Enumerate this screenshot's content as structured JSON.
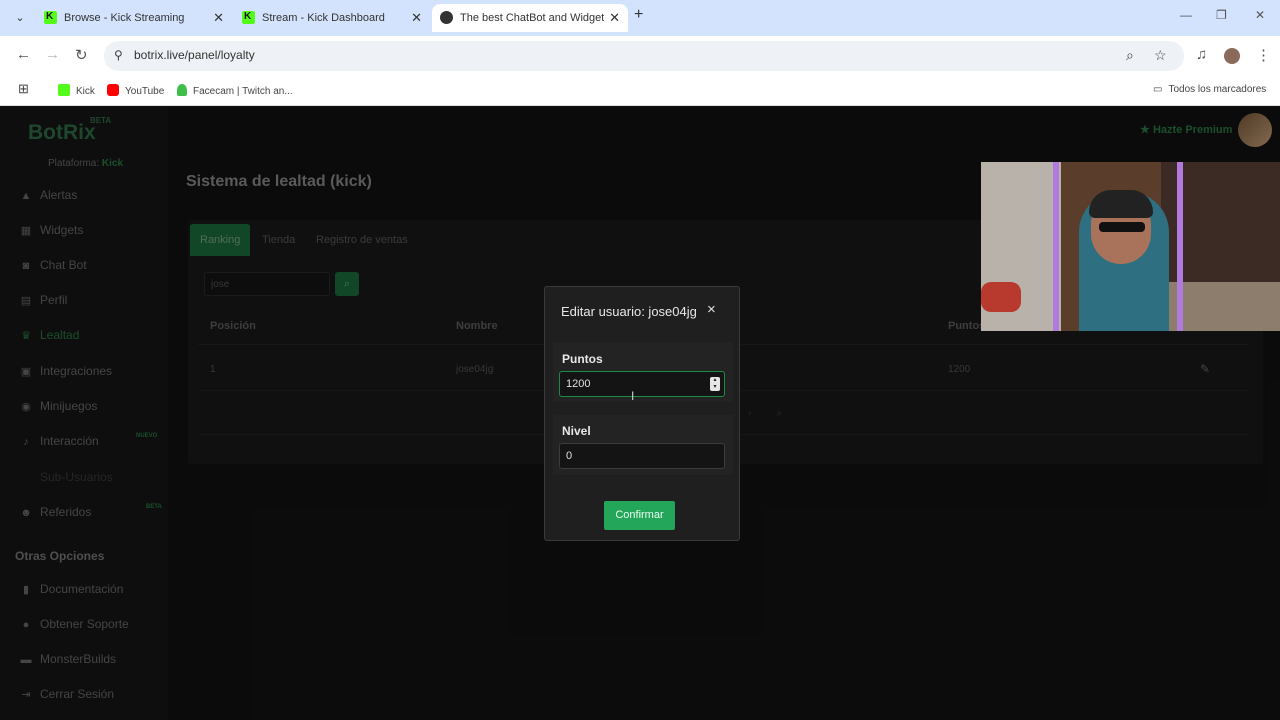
{
  "browser": {
    "tabs": [
      {
        "title": "Browse - Kick Streaming",
        "active": false
      },
      {
        "title": "Stream - Kick Dashboard",
        "active": false
      },
      {
        "title": "The best ChatBot and Widgets f",
        "active": true
      }
    ],
    "url": "botrix.live/panel/loyalty",
    "bookmarks": [
      "Kick",
      "YouTube",
      "Facecam | Twitch an...",
      "Todos los marcadores"
    ]
  },
  "sidebar": {
    "logo": "BotRix",
    "beta": "BETA",
    "platform_label": "Plataforma:",
    "platform_value": "Kick",
    "items": [
      {
        "label": "Alertas",
        "icon": "warning-icon"
      },
      {
        "label": "Widgets",
        "icon": "grid-icon"
      },
      {
        "label": "Chat Bot",
        "icon": "robot-icon"
      },
      {
        "label": "Perfil",
        "icon": "id-card-icon"
      },
      {
        "label": "Lealtad",
        "icon": "trophy-icon"
      },
      {
        "label": "Integraciones",
        "icon": "integrations-icon"
      },
      {
        "label": "Minijuegos",
        "icon": "gamepad-icon"
      },
      {
        "label": "Interacción",
        "icon": "interaction-icon",
        "tag": "NUEVO"
      },
      {
        "label": "Sub-Usuarios",
        "icon": ""
      },
      {
        "label": "Referidos",
        "icon": "users-icon",
        "tag": "BETA"
      }
    ],
    "other_title": "Otras Opciones",
    "other_items": [
      {
        "label": "Documentación",
        "icon": "book-icon"
      },
      {
        "label": "Obtener Soporte",
        "icon": "help-icon"
      },
      {
        "label": "MonsterBuilds",
        "icon": "monitor-icon"
      },
      {
        "label": "Cerrar Sesión",
        "icon": "logout-icon"
      }
    ]
  },
  "header": {
    "title": "Sistema de lealtad (kick)",
    "premium": "Hazte Premium"
  },
  "panel": {
    "tabs": [
      "Ranking",
      "Tienda",
      "Registro de ventas"
    ],
    "search_value": "jose",
    "columns": [
      "Posición",
      "Nombre",
      "Puntos"
    ],
    "rows": [
      {
        "position": "1",
        "name": "jose04jg",
        "points": "1200"
      }
    ]
  },
  "modal": {
    "title": "Editar usuario: jose04jg",
    "close": "×",
    "points_label": "Puntos",
    "points_value": "1200",
    "level_label": "Nivel",
    "level_value": "0",
    "confirm": "Confirmar"
  },
  "colors": {
    "accent": "#23a55a",
    "brand": "#53fc18"
  }
}
